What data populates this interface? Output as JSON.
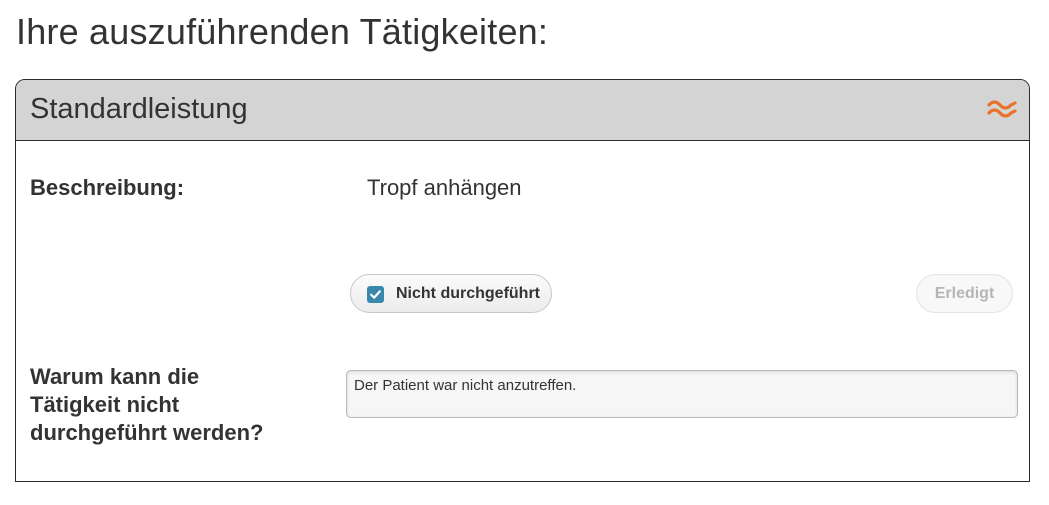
{
  "page": {
    "title": "Ihre auszuführenden Tätigkeiten:"
  },
  "panel": {
    "title": "Standardleistung",
    "collapse_icon": "double-wave-collapse-icon",
    "accent_color": "#e8722a",
    "header_color": "#d4d4d4"
  },
  "description": {
    "label": "Beschreibung:",
    "value": "Tropf anhängen"
  },
  "actions": {
    "not_done_label": "Nicht durchgeführt",
    "not_done_checked": true,
    "checkbox_color": "#3a87ad",
    "done_label": "Erledigt",
    "done_enabled": false
  },
  "reason": {
    "label": "Warum kann die Tätigkeit nicht durchgeführt werden?",
    "value": "Der Patient war nicht anzutreffen."
  }
}
